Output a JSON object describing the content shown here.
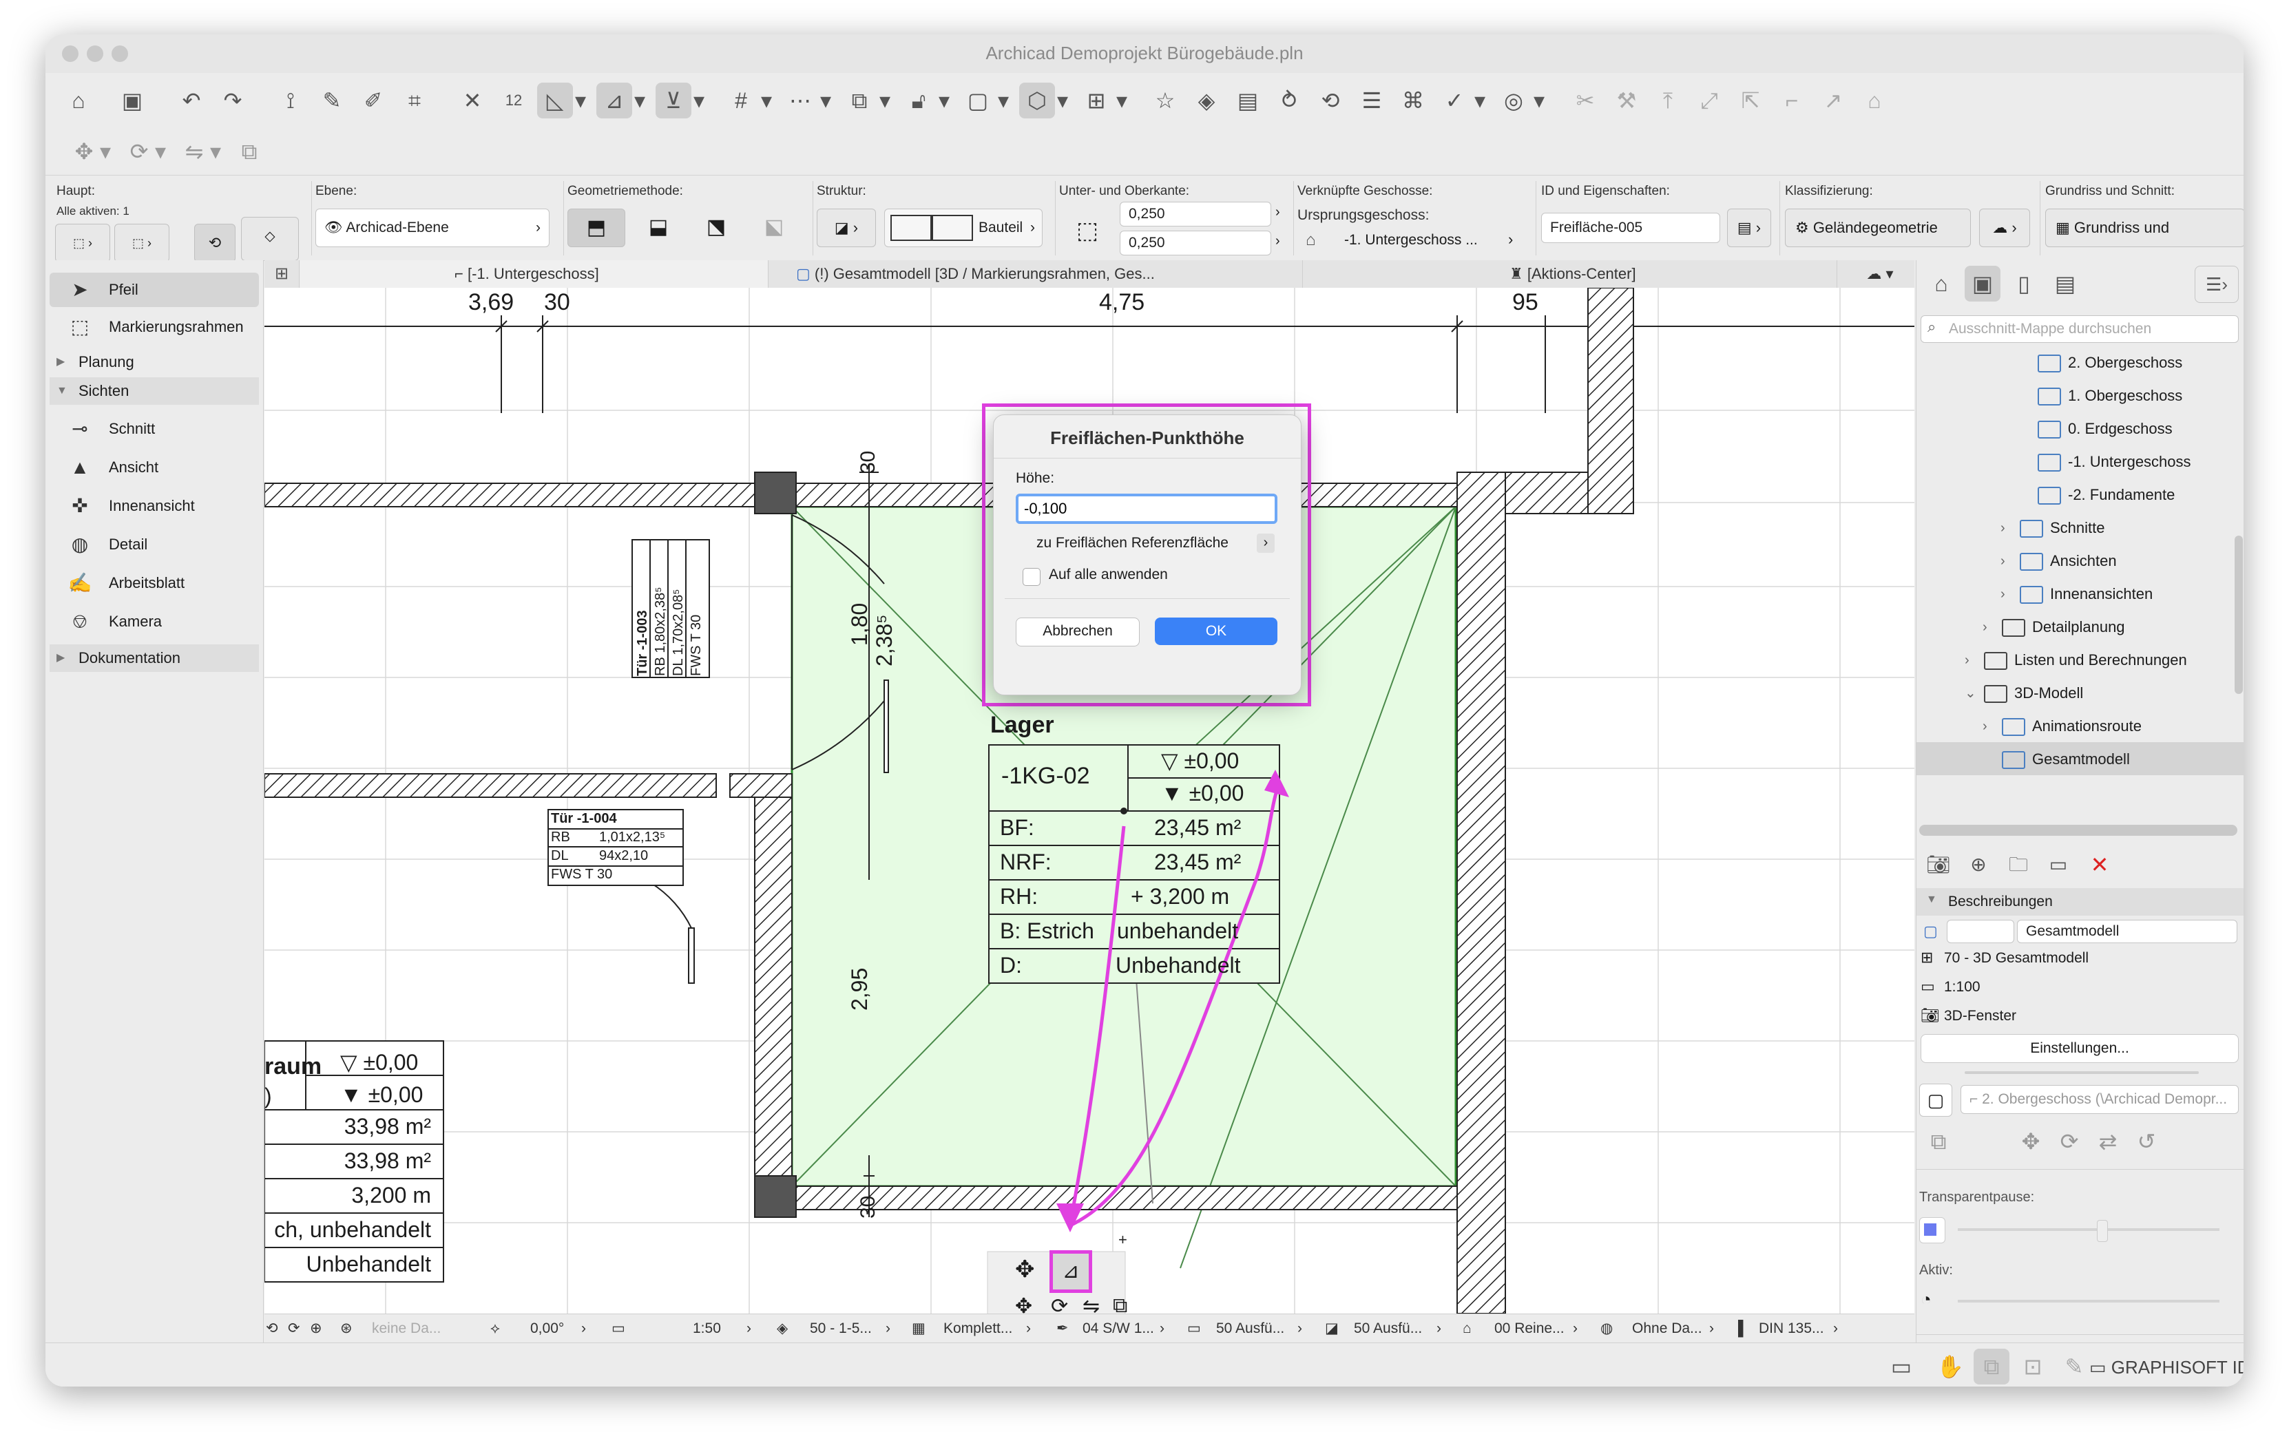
{
  "window": {
    "title": "Archicad Demoprojekt Bürogebäude.pln"
  },
  "infobox": {
    "haupt_label": "Haupt:",
    "alle_aktiven": "Alle aktiven: 1",
    "ebene_label": "Ebene:",
    "ebene_value": "Archicad-Ebene",
    "geometrie_label": "Geometriemethode:",
    "struktur_label": "Struktur:",
    "struktur_value": "Bauteil",
    "unterober_label": "Unter- und Oberkante:",
    "unterkante": "0,250",
    "oberkante": "0,250",
    "verknuepfte_label": "Verknüpfte Geschosse:",
    "ursprung_label": "Ursprungsgeschoss:",
    "ursprung_value": "-1. Untergeschoss ...",
    "id_label": "ID und Eigenschaften:",
    "id_value": "Freifläche-005",
    "klass_label": "Klassifizierung:",
    "klass_value": "Geländegeometrie",
    "grundriss_label": "Grundriss und Schnitt:",
    "grundriss_value": "Grundriss und"
  },
  "tabs": [
    {
      "label": "[-1. Untergeschoss]"
    },
    {
      "label": "(!) Gesamtmodell [3D / Markierungsrahmen, Ges..."
    },
    {
      "label": "[Aktions-Center]"
    }
  ],
  "sidebar": {
    "tools": [
      {
        "label": "Pfeil",
        "icon": "arrow-icon"
      },
      {
        "label": "Markierungsrahmen",
        "icon": "marquee-icon"
      }
    ],
    "group_planung": "Planung",
    "group_sichten": "Sichten",
    "sichten": [
      {
        "label": "Schnitt",
        "icon": "section-icon"
      },
      {
        "label": "Ansicht",
        "icon": "elevation-icon"
      },
      {
        "label": "Innenansicht",
        "icon": "interior-elevation-icon"
      },
      {
        "label": "Detail",
        "icon": "detail-icon"
      },
      {
        "label": "Arbeitsblatt",
        "icon": "worksheet-icon"
      },
      {
        "label": "Kamera",
        "icon": "camera-icon"
      }
    ],
    "group_dokumentation": "Dokumentation"
  },
  "drawing": {
    "dim_369": "3,69",
    "dim_30a": "30",
    "dim_475": "4,75",
    "dim_95": "95",
    "dim_30_top": "30",
    "dim_180": "1,80",
    "dim_2385": "2,38⁵",
    "dim_295": "2,95",
    "dim_30_bot": "30",
    "door1": {
      "id": "Tür -1-003",
      "rb": "RB  1,80x2,38⁵",
      "dl": "DL  1,70x2,08⁵",
      "fws": "FWS  T 30"
    },
    "door2": {
      "id": "Tür -1-004",
      "rb": "RB",
      "rb_v": "1,01x2,13⁵",
      "dl": "DL",
      "dl_v": "94x2,10",
      "fws": "FWS  T 30"
    },
    "room": {
      "name": "Lager",
      "number": "-1KG-02",
      "lvl1": "▽ ±0,00",
      "lvl2": "▼ ±0,00",
      "bf_label": "BF:",
      "bf_value": "23,45 m²",
      "nrf_label": "NRF:",
      "nrf_value": "23,45 m²",
      "rh_label": "RH:",
      "rh_value": "+ 3,200 m",
      "b_label": "B: Estrich",
      "b_value": "unbehandelt",
      "d_label": "D:",
      "d_value": "Unbehandelt"
    },
    "room2": {
      "name": "raum",
      "n0": ")",
      "lvl1": "▽ ±0,00",
      "lvl2": "▼ ±0,00",
      "v1": "33,98 m²",
      "v2": "33,98 m²",
      "v3": "3,200 m",
      "v4": "ch, unbehandelt",
      "v5": "Unbehandelt"
    }
  },
  "dialog": {
    "title": "Freiflächen-Punkthöhe",
    "hoehe_label": "Höhe:",
    "hoehe_value": "-0,100",
    "ref_label": "zu Freiflächen Referenzfläche",
    "alle_label": "Auf alle anwenden",
    "cancel": "Abbrechen",
    "ok": "OK"
  },
  "navigator": {
    "search_placeholder": "Ausschnitt-Mappe durchsuchen",
    "items": [
      {
        "label": "2. Obergeschoss",
        "indent": 3
      },
      {
        "label": "1. Obergeschoss",
        "indent": 3
      },
      {
        "label": "0. Erdgeschoss",
        "indent": 3
      },
      {
        "label": "-1. Untergeschoss",
        "indent": 3
      },
      {
        "label": "-2. Fundamente",
        "indent": 3
      },
      {
        "label": "Schnitte",
        "indent": 2
      },
      {
        "label": "Ansichten",
        "indent": 2
      },
      {
        "label": "Innenansichten",
        "indent": 2
      },
      {
        "label": "Detailplanung",
        "indent": 1
      },
      {
        "label": "Listen und Berechnungen",
        "indent": 0
      },
      {
        "label": "3D-Modell",
        "indent": 0
      },
      {
        "label": "Animationsroute",
        "indent": 1
      },
      {
        "label": "Gesamtmodell",
        "indent": 1
      }
    ],
    "beschreibungen": "Beschreibungen",
    "name_value": "Gesamtmodell",
    "ref": "70 - 3D Gesamtmodell",
    "scale": "1:100",
    "fenster": "3D-Fenster",
    "einstellungen": "Einstellungen...",
    "layer_value": "2. Obergeschoss (\\Archicad Demopr...",
    "transparent": "Transparentpause:",
    "aktiv": "Aktiv:"
  },
  "statusbar": {
    "keine": "keine Da...",
    "angle": "0,00°",
    "scale": "1:50",
    "layers": "50 - 1-5...",
    "komplett": "Komplett...",
    "pen": "04 S/W 1...",
    "ausfue1": "50 Ausfü...",
    "ausfue2": "50 Ausfü...",
    "reine": "00 Reine...",
    "ohne": "Ohne Da...",
    "din": "DIN 135..."
  },
  "footer": {
    "brand": "GRAPHISOFT ID"
  },
  "colors": {
    "accent": "#3a82f7",
    "highlight": "#e040e0",
    "zone_fill": "#e6fbe3",
    "zone_edge": "#2f8f2f"
  }
}
